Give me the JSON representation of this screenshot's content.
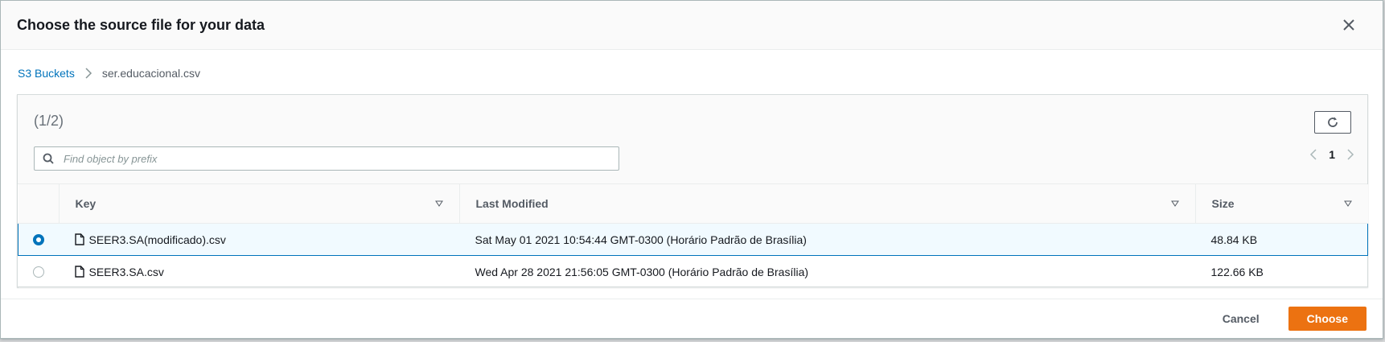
{
  "dialog": {
    "title": "Choose the source file for your data",
    "close_icon": "close-icon"
  },
  "breadcrumb": {
    "root": "S3 Buckets",
    "current": "ser.educacional.csv",
    "separator_icon": "chevron-right-icon"
  },
  "panel": {
    "count": "(1/2)",
    "refresh_icon": "refresh-icon",
    "search": {
      "placeholder": "Find object by prefix",
      "value": "",
      "icon": "search-icon"
    },
    "pagination": {
      "current_page": "1",
      "prev_icon": "chevron-left-icon",
      "next_icon": "chevron-right-icon"
    }
  },
  "table": {
    "columns": [
      {
        "label": "Key",
        "sort_icon": "sort-triangle-icon"
      },
      {
        "label": "Last Modified",
        "sort_icon": "sort-triangle-icon"
      },
      {
        "label": "Size",
        "sort_icon": "sort-triangle-icon"
      }
    ],
    "rows": [
      {
        "selected": true,
        "key": "SEER3.SA(modificado).csv",
        "last_modified": "Sat May 01 2021 10:54:44 GMT-0300 (Horário Padrão de Brasília)",
        "size": "48.84 KB"
      },
      {
        "selected": false,
        "key": "SEER3.SA.csv",
        "last_modified": "Wed Apr 28 2021 21:56:05 GMT-0300 (Horário Padrão de Brasília)",
        "size": "122.66 KB"
      }
    ]
  },
  "footer": {
    "cancel_label": "Cancel",
    "choose_label": "Choose"
  },
  "colors": {
    "accent": "#0073bb",
    "primary_button": "#ec7211"
  }
}
